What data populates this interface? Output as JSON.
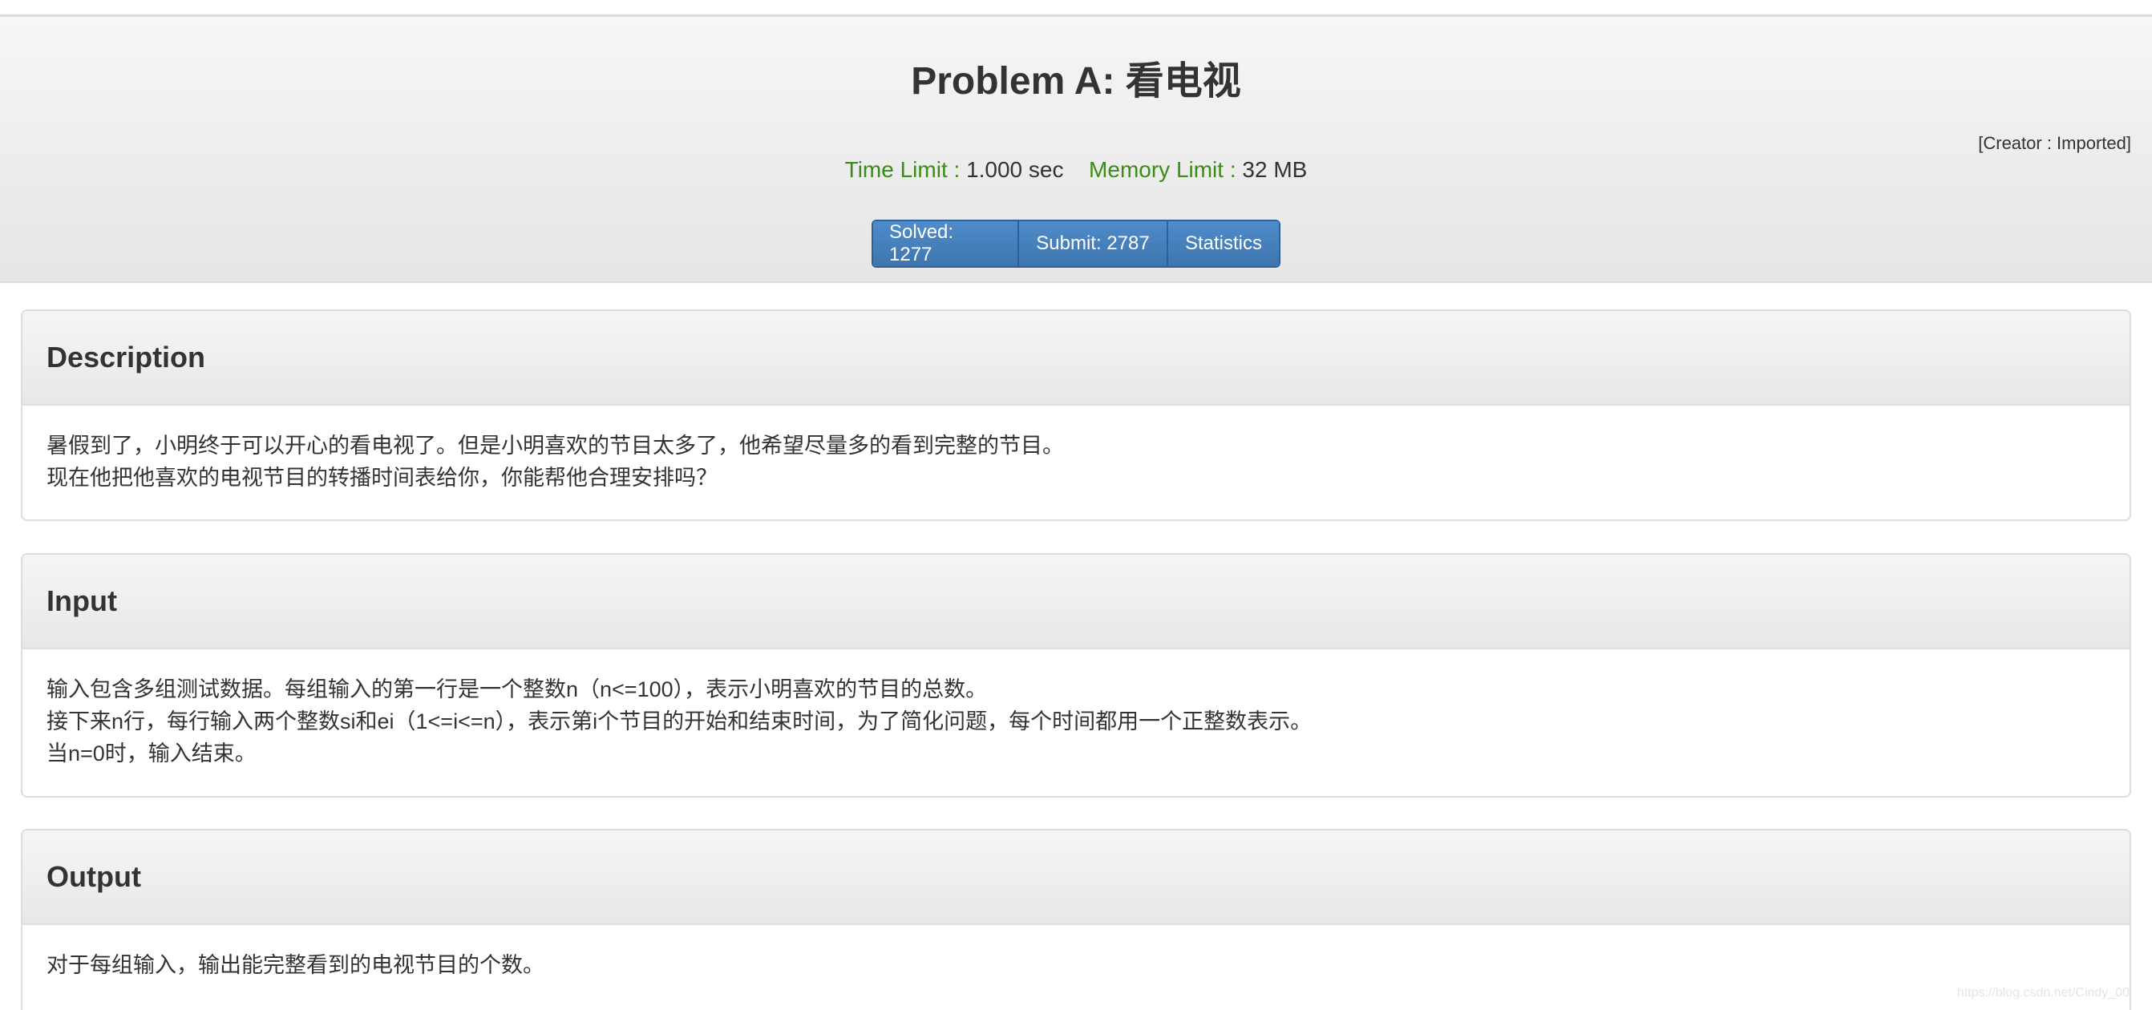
{
  "header": {
    "title": "Problem A: 看电视",
    "creator": "[Creator : Imported]",
    "time_limit_label": "Time Limit :",
    "time_limit_value": "1.000 sec",
    "memory_limit_label": "Memory Limit :",
    "memory_limit_value": "32 MB",
    "buttons": {
      "solved": "Solved: 1277",
      "submit": "Submit: 2787",
      "statistics": "Statistics"
    }
  },
  "sections": {
    "description": {
      "heading": "Description",
      "lines": [
        "暑假到了，小明终于可以开心的看电视了。但是小明喜欢的节目太多了，他希望尽量多的看到完整的节目。",
        "现在他把他喜欢的电视节目的转播时间表给你，你能帮他合理安排吗？"
      ]
    },
    "input": {
      "heading": "Input",
      "lines": [
        "输入包含多组测试数据。每组输入的第一行是一个整数n（n<=100），表示小明喜欢的节目的总数。",
        "接下来n行，每行输入两个整数si和ei（1<=i<=n），表示第i个节目的开始和结束时间，为了简化问题，每个时间都用一个正整数表示。",
        "当n=0时，输入结束。"
      ]
    },
    "output": {
      "heading": "Output",
      "lines": [
        "对于每组输入，输出能完整看到的电视节目的个数。"
      ]
    }
  },
  "watermark": "https://blog.csdn.net/Cindy_00",
  "colors": {
    "label_green": "#3c8b17",
    "button_blue": "#3e75ae",
    "text": "#333333"
  }
}
